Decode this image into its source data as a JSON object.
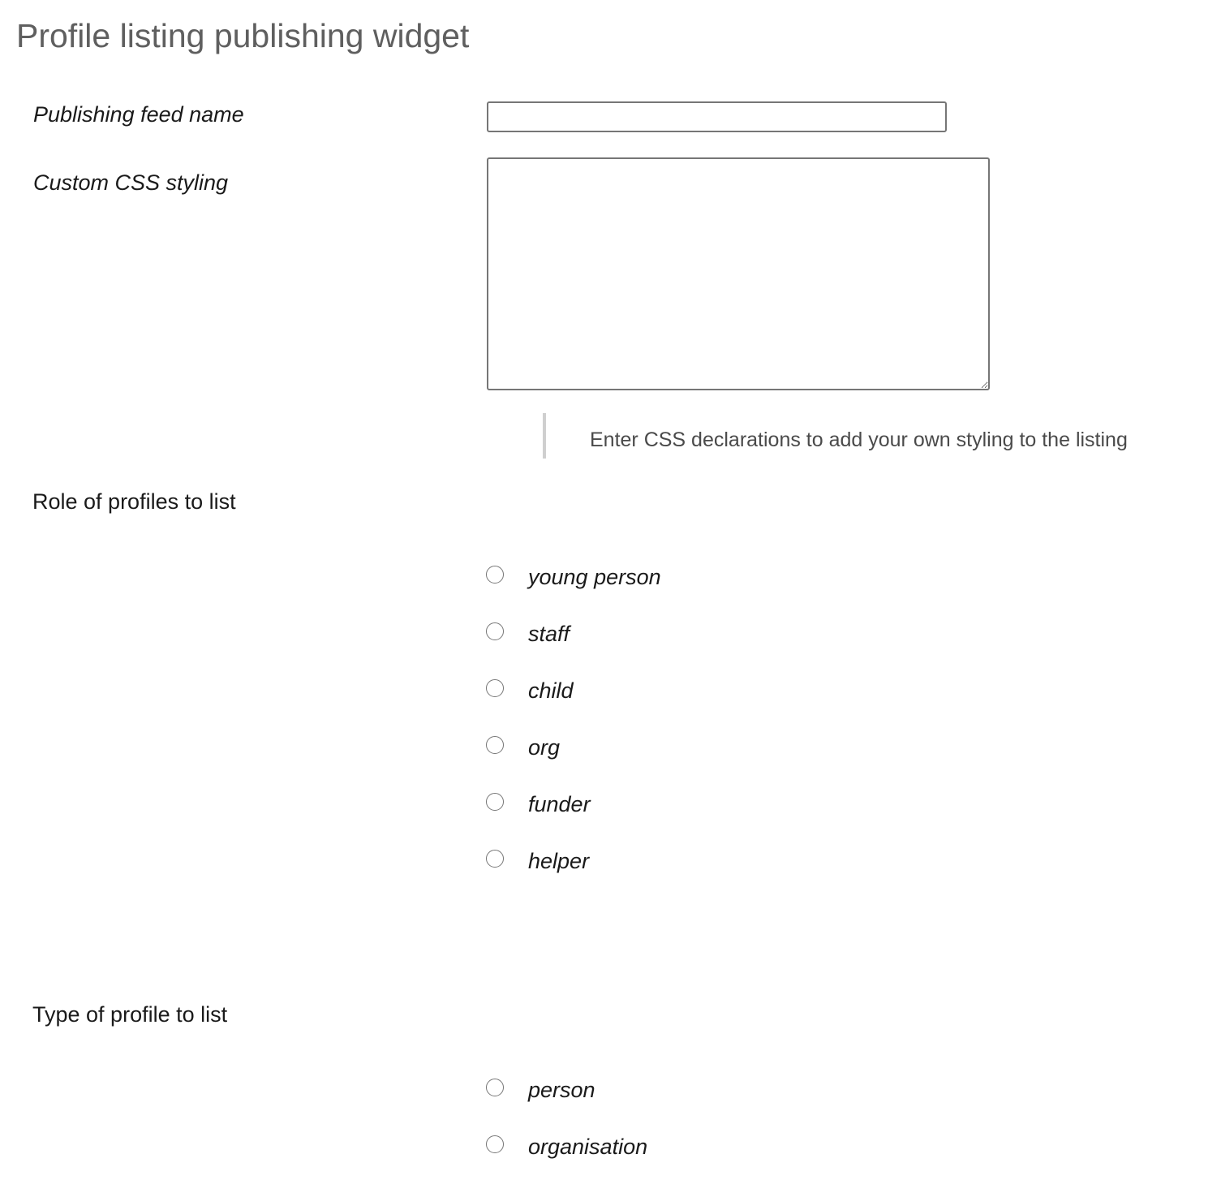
{
  "page": {
    "title": "Profile listing publishing widget"
  },
  "form": {
    "feed_name": {
      "label": "Publishing feed name",
      "value": "",
      "placeholder": ""
    },
    "custom_css": {
      "label": "Custom CSS styling",
      "value": "",
      "help": "Enter CSS declarations to add your own styling to the listing"
    },
    "role_group": {
      "label": "Role of profiles to list",
      "options": [
        {
          "label": "young person",
          "checked": false
        },
        {
          "label": "staff",
          "checked": false
        },
        {
          "label": "child",
          "checked": false
        },
        {
          "label": "org",
          "checked": false
        },
        {
          "label": "funder",
          "checked": false
        },
        {
          "label": "helper",
          "checked": false
        }
      ]
    },
    "type_group": {
      "label": "Type of profile to list",
      "options": [
        {
          "label": "person",
          "checked": false
        },
        {
          "label": "organisation",
          "checked": false
        }
      ]
    }
  }
}
